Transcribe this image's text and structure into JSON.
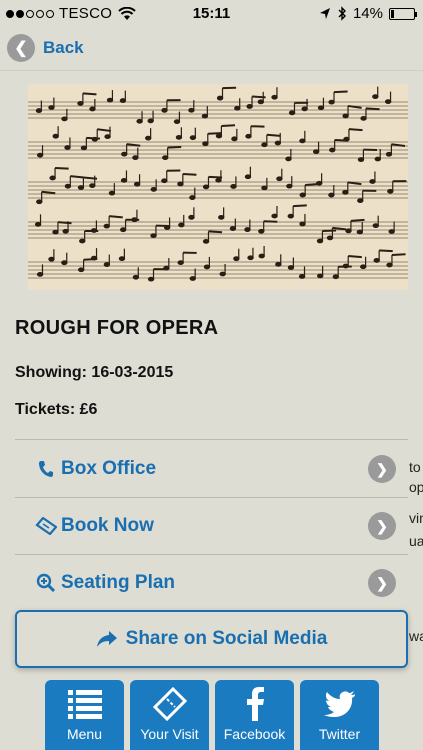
{
  "status": {
    "carrier": "TESCO",
    "time": "15:11",
    "battery": "14%",
    "battery_level": 0.14
  },
  "nav": {
    "back_label": "Back"
  },
  "event": {
    "title": "ROUGH FOR OPERA",
    "showing": "Showing: 16-03-2015",
    "tickets": "Tickets: £6"
  },
  "actions": [
    {
      "label": "Box Office",
      "icon": "phone-icon"
    },
    {
      "label": "Book Now",
      "icon": "ticket-icon"
    },
    {
      "label": "Seating Plan",
      "icon": "zoom-icon"
    }
  ],
  "share": {
    "label": "Share on Social Media",
    "icon": "share-icon"
  },
  "clipped_text": [
    "to",
    "op",
    "vin",
    "ual",
    "wa"
  ],
  "tabs": [
    {
      "label": "Menu",
      "icon": "list-icon"
    },
    {
      "label": "Your Visit",
      "icon": "ticket-icon"
    },
    {
      "label": "Facebook",
      "icon": "facebook-icon"
    },
    {
      "label": "Twitter",
      "icon": "twitter-icon"
    }
  ],
  "colors": {
    "accent": "#1a6fb0",
    "tab_bg": "#1a7bc0",
    "background": "#ddddd3"
  }
}
